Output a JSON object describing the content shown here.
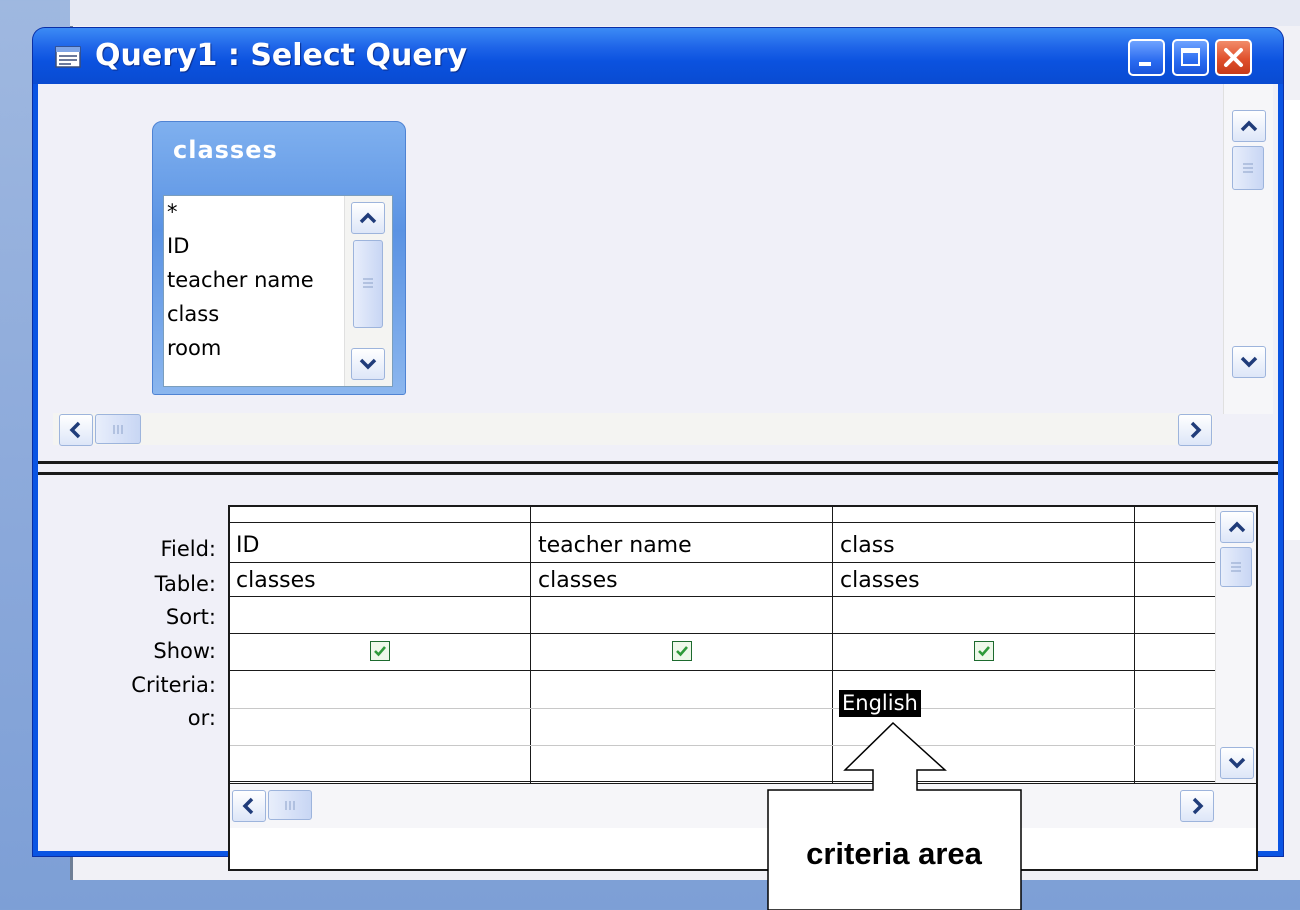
{
  "window": {
    "title": "Query1 : Select Query"
  },
  "table_box": {
    "name": "classes",
    "fields": [
      "*",
      "ID",
      "teacher name",
      "class",
      "room"
    ]
  },
  "design_grid": {
    "row_labels": [
      "Field:",
      "Table:",
      "Sort:",
      "Show:",
      "Criteria:",
      "or:"
    ],
    "columns": [
      {
        "field": "ID",
        "table": "classes",
        "sort": "",
        "show": true,
        "criteria": "",
        "or": ""
      },
      {
        "field": "teacher name",
        "table": "classes",
        "sort": "",
        "show": true,
        "criteria": "",
        "or": ""
      },
      {
        "field": "class",
        "table": "classes",
        "sort": "",
        "show": true,
        "criteria": "English",
        "or": ""
      }
    ]
  },
  "callout": {
    "label": "criteria area"
  },
  "icons": {
    "title": "query-window-icon",
    "minimize": "minimize-icon",
    "maximize": "maximize-icon",
    "close": "close-icon"
  },
  "colors": {
    "titlebar": "#0a52df",
    "checkmark": "#2e9a3a",
    "close_button": "#e0502c",
    "selection": "#000000"
  }
}
